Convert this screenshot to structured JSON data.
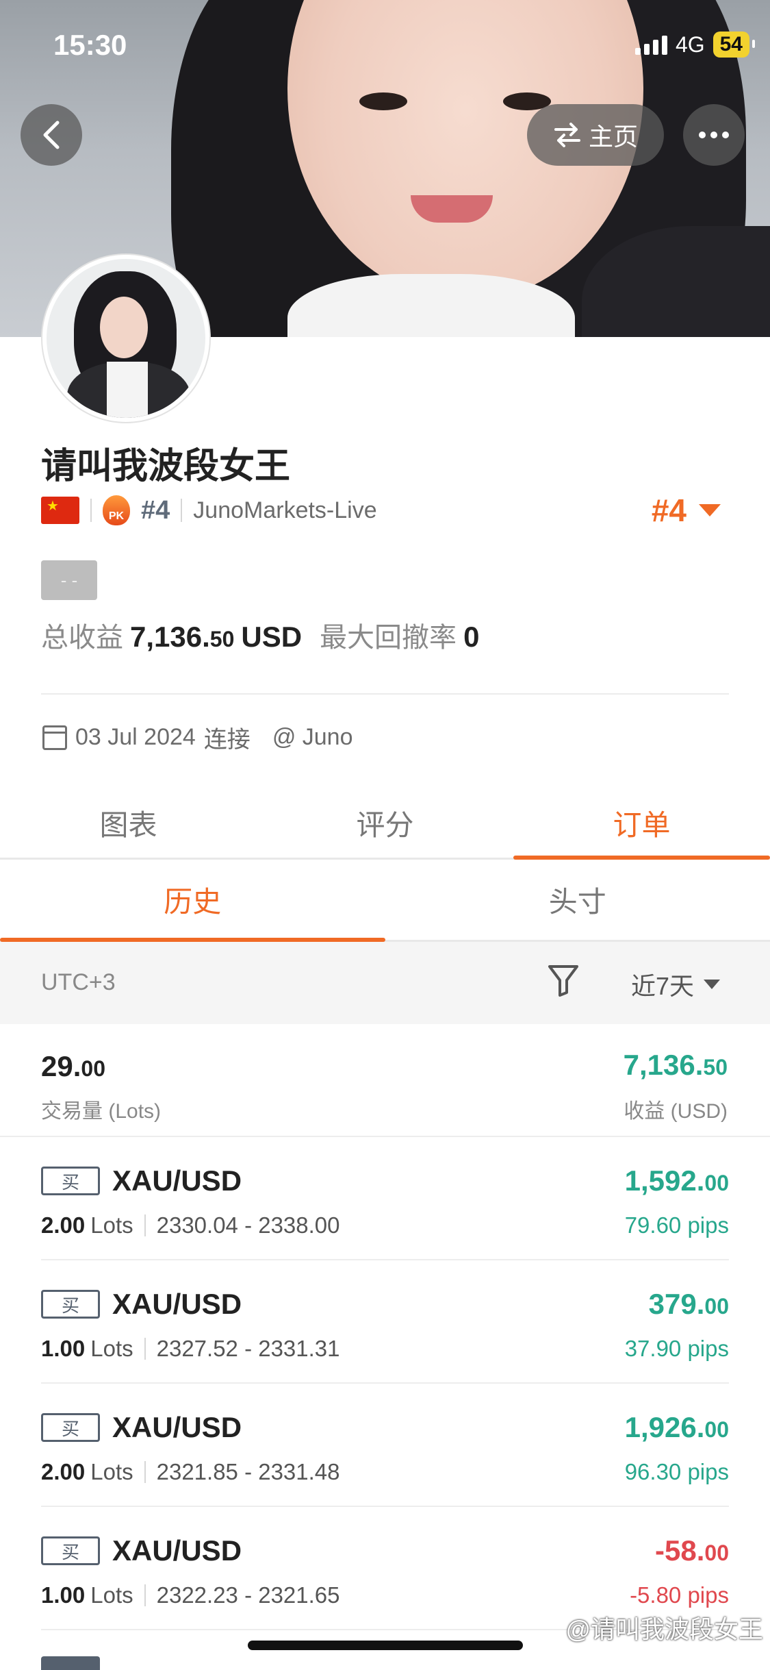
{
  "status_bar": {
    "time": "15:30",
    "network": "4G",
    "battery": "54"
  },
  "header": {
    "home_label": "主页",
    "back_icon": "chevron-left-icon",
    "more_icon": "more-horizontal-icon",
    "swap_icon": "swap-arrows-icon"
  },
  "profile": {
    "name": "请叫我波段女王",
    "rank_small": "#4",
    "server": "JunoMarkets-Live",
    "rank_big": "#4",
    "tag": "- -",
    "total_profit_label": "总收益",
    "total_profit_int": "7,136.",
    "total_profit_dec": "50",
    "total_profit_unit": "USD",
    "max_drawdown_label": "最大回撤率",
    "max_drawdown_value": "0",
    "pk_label": "PK",
    "join_date": "03 Jul 2024",
    "join_label": "连接",
    "broker": "@ Juno"
  },
  "tabs": [
    "图表",
    "评分",
    "订单"
  ],
  "subtabs": [
    "历史",
    "头寸"
  ],
  "filter": {
    "timezone": "UTC+3",
    "range": "近7天"
  },
  "summary": {
    "lots_int": "29.",
    "lots_dec": "00",
    "lots_label": "交易量 (Lots)",
    "profit_int": "7,136.",
    "profit_dec": "50",
    "profit_label": "收益 (USD)"
  },
  "orders": [
    {
      "side": "买",
      "pair": "XAU/USD",
      "lots": "2.00",
      "lots_unit": "Lots",
      "range": "2330.04 - 2338.00",
      "profit_int": "1,592.",
      "profit_dec": "00",
      "pips": "79.60 pips"
    },
    {
      "side": "买",
      "pair": "XAU/USD",
      "lots": "1.00",
      "lots_unit": "Lots",
      "range": "2327.52 - 2331.31",
      "profit_int": "379.",
      "profit_dec": "00",
      "pips": "37.90 pips"
    },
    {
      "side": "买",
      "pair": "XAU/USD",
      "lots": "2.00",
      "lots_unit": "Lots",
      "range": "2321.85 - 2331.48",
      "profit_int": "1,926.",
      "profit_dec": "00",
      "pips": "96.30 pips"
    },
    {
      "side": "买",
      "pair": "XAU/USD",
      "lots": "1.00",
      "lots_unit": "Lots",
      "range": "2322.23 - 2321.65",
      "profit_int": "-58.",
      "profit_dec": "00",
      "pips": "-5.80 pips"
    }
  ],
  "watermark": "@请叫我波段女王",
  "colors": {
    "accent": "#f06a25",
    "positive": "#27a78c",
    "negative": "#e0484e"
  }
}
